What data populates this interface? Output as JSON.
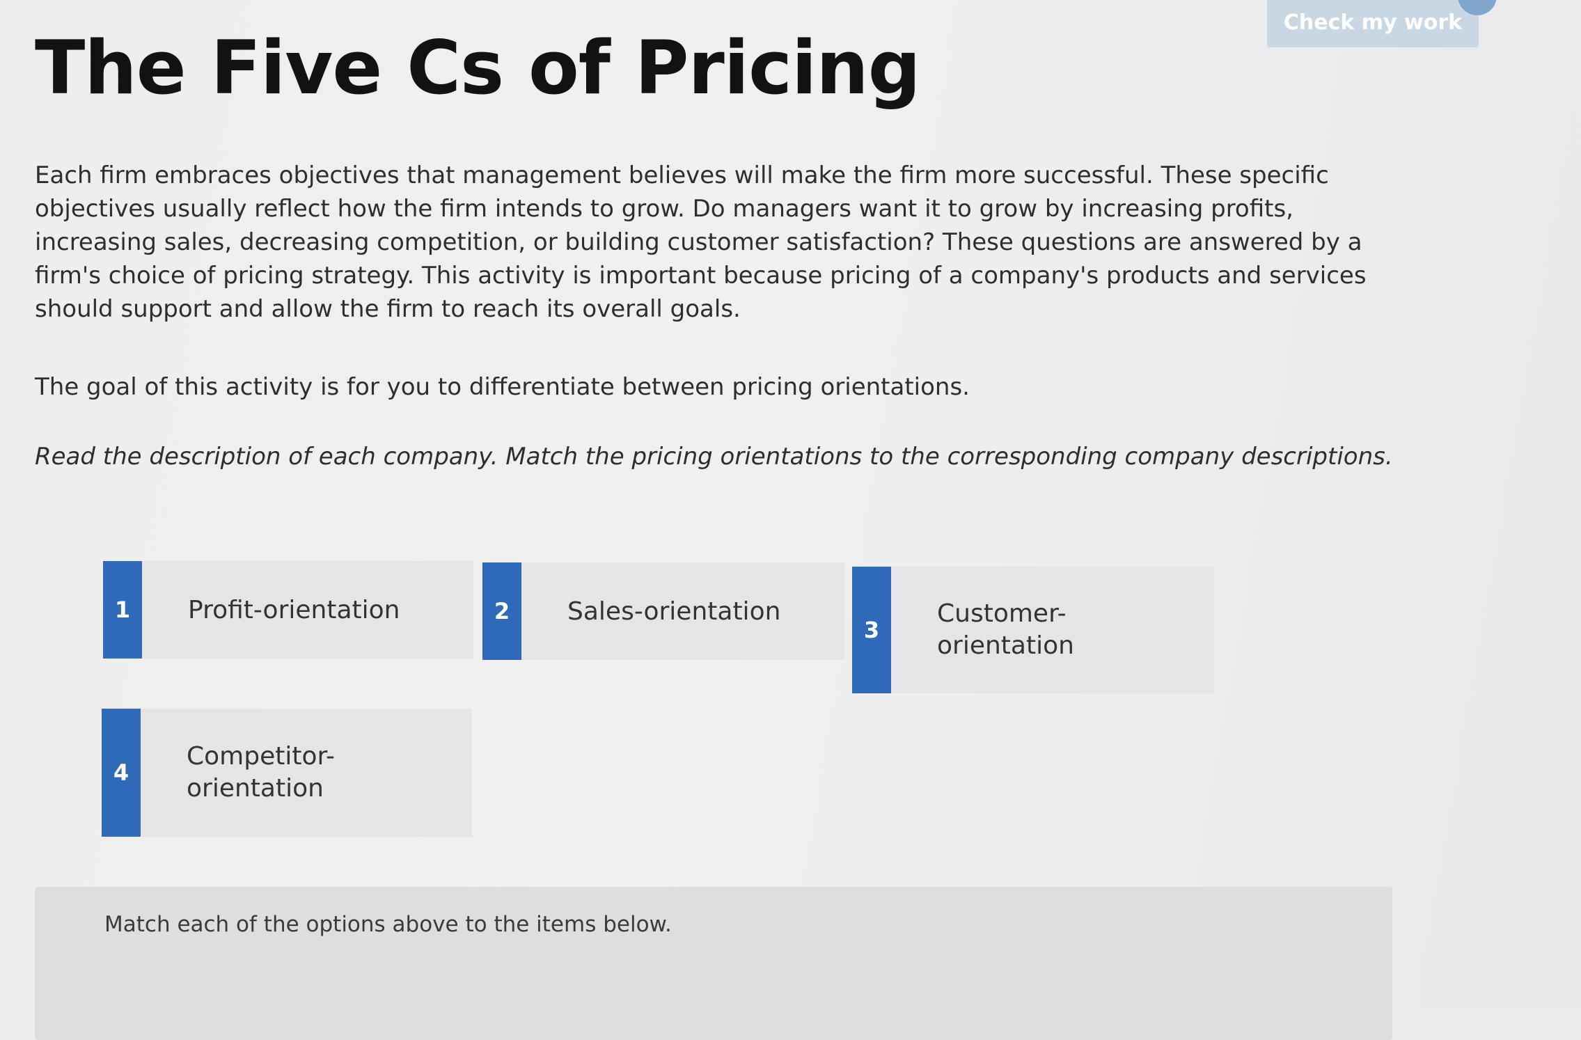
{
  "header": {
    "check_button_label": "Check my work"
  },
  "page": {
    "title": "The Five Cs of Pricing",
    "intro": "Each firm embraces objectives that management believes will make the firm more successful. These specific objectives usually reflect how the firm intends to grow. Do managers want it to grow by increasing profits, increasing sales, decreasing competition, or building customer satisfaction? These questions are answered by a firm's choice of pricing strategy. This activity is important because pricing of a company's products and services should support and allow the firm to reach its overall goals.",
    "goal": "The goal of this activity is for you to differentiate between pricing orientations.",
    "instructions": "Read the description of each company. Match the pricing orientations to the corresponding company descriptions."
  },
  "options": [
    {
      "number": "1",
      "label": "Profit-orientation"
    },
    {
      "number": "2",
      "label": "Sales-orientation"
    },
    {
      "number": "3",
      "label": "Customer-orientation"
    },
    {
      "number": "4",
      "label": "Competitor-orientation"
    }
  ],
  "match_area": {
    "prompt": "Match each of the options above to the items below."
  },
  "colors": {
    "accent": "#2f6ab8",
    "option_background": "#e5e5e7",
    "check_button_background": "#c9d6e3"
  }
}
